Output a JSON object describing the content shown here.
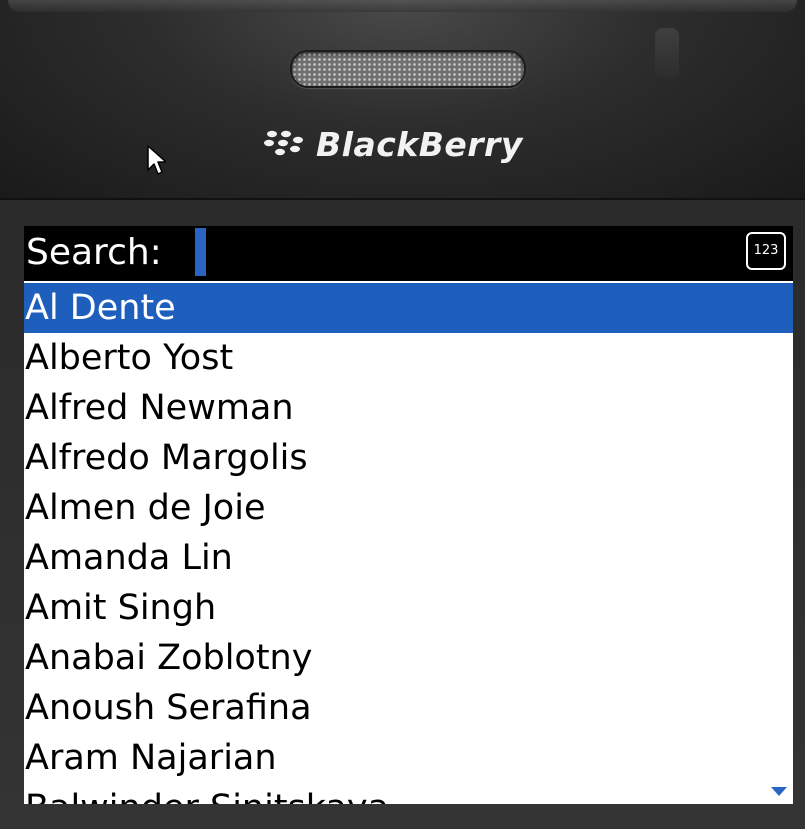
{
  "device": {
    "brand_name": "BlackBerry",
    "icons": [
      "blackberry-logo-icon",
      "mouse-pointer-icon",
      "speaker-grille",
      "scroll-down-arrow-icon"
    ]
  },
  "search": {
    "label": "Search:",
    "value": "",
    "mode_indicator": "123"
  },
  "contacts": [
    "Al Dente",
    "Alberto Yost",
    "Alfred Newman",
    "Alfredo Margolis",
    "Almen de Joie",
    "Amanda Lin",
    "Amit Singh",
    "Anabai Zoblotny",
    "Anoush Serafina",
    "Aram Najarian",
    "Balwinder Sinitskaya"
  ],
  "selected_index": 0,
  "colors": {
    "selection": "#1e5ebd",
    "caret": "#2b63c5",
    "scroll_arrow": "#2a64c4"
  }
}
